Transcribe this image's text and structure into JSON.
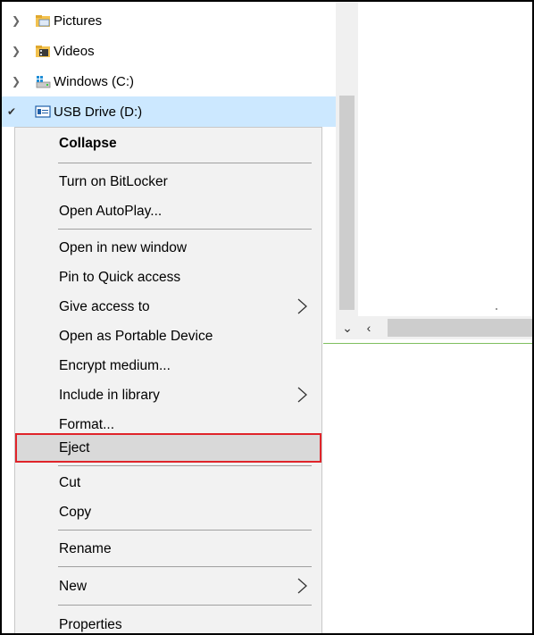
{
  "tree": {
    "items": [
      {
        "label": "Pictures",
        "icon": "pictures-folder-icon"
      },
      {
        "label": "Videos",
        "icon": "videos-folder-icon"
      },
      {
        "label": "Windows (C:)",
        "icon": "windows-drive-icon"
      },
      {
        "label": "USB Drive (D:)",
        "icon": "usb-drive-icon",
        "selected": true
      }
    ]
  },
  "menu": {
    "items": [
      {
        "label": "Collapse",
        "bold": true
      },
      {
        "label": "Turn on BitLocker"
      },
      {
        "label": "Open AutoPlay..."
      },
      {
        "label": "Open in new window"
      },
      {
        "label": "Pin to Quick access"
      },
      {
        "label": "Give access to",
        "submenu": true
      },
      {
        "label": "Open as Portable Device"
      },
      {
        "label": "Encrypt medium..."
      },
      {
        "label": "Include in library",
        "submenu": true
      },
      {
        "label": "Format..."
      },
      {
        "label": "Eject",
        "highlighted": true
      },
      {
        "label": "Cut"
      },
      {
        "label": "Copy"
      },
      {
        "label": "Rename"
      },
      {
        "label": "New",
        "submenu": true
      },
      {
        "label": "Properties"
      }
    ]
  },
  "colors": {
    "selection": "#cce8ff",
    "highlight_border": "#e0242a",
    "menu_bg": "#f2f2f2"
  }
}
